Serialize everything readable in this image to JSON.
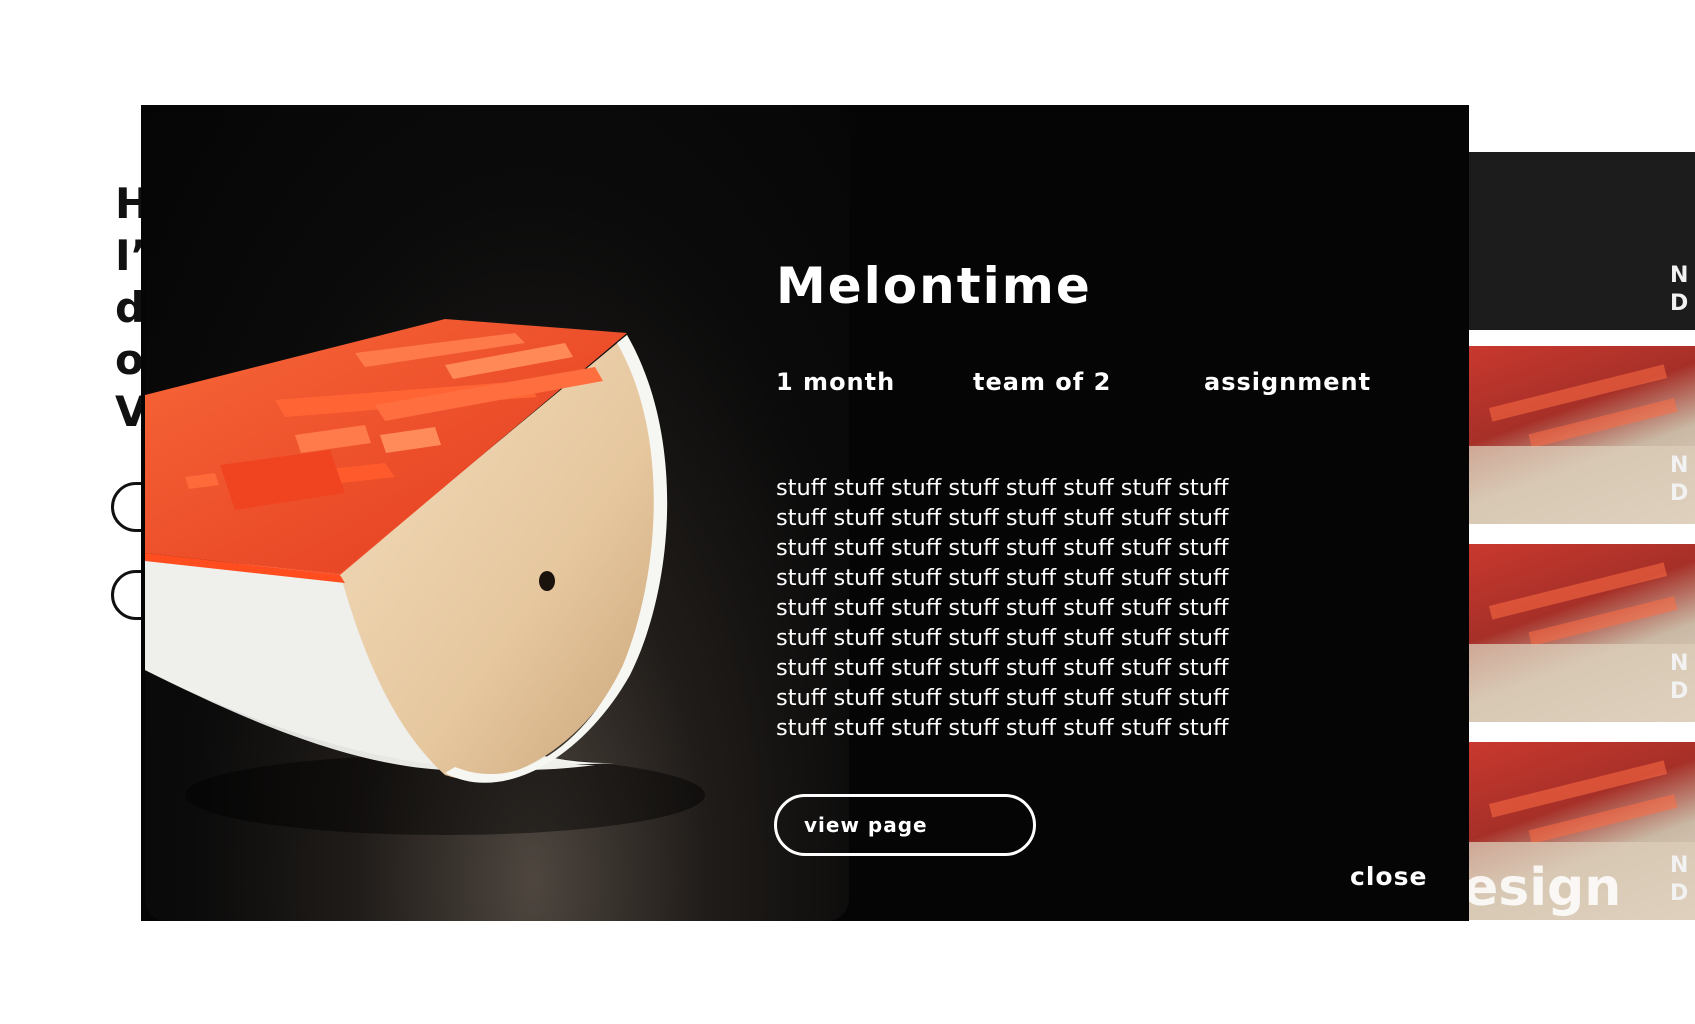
{
  "background": {
    "intro_lines": [
      "H",
      "I’",
      "d",
      "o",
      "V"
    ],
    "pill_1_label": "",
    "pill_2_label": "",
    "side_labels": [
      [
        "N",
        "D"
      ],
      [
        "N",
        "D"
      ],
      [
        "N",
        "D"
      ],
      [
        "N",
        "D"
      ]
    ],
    "partial_heading": "esign"
  },
  "modal": {
    "title": "Melontime",
    "meta": {
      "duration": "1 month",
      "team": "team of 2",
      "type": "assignment"
    },
    "description": "stuff stuff stuff stuff stuff stuff stuff stuff\nstuff stuff stuff stuff  stuff stuff stuff stuff\nstuff stuff stuff stuff stuff stuff stuff stuff\nstuff stuff stuff stuff stuff stuff stuff stuff\nstuff stuff stuff stuff  stuff stuff stuff stuff\nstuff stuff stuff stuff stuff stuff stuff stuff\nstuff stuff stuff stuff stuff stuff stuff stuff\nstuff stuff stuff stuff  stuff stuff stuff stuff\nstuff stuff stuff stuff stuff stuff stuff stuff",
    "view_button_label": "view page",
    "close_label": "close"
  },
  "colors": {
    "modal_background": "#050505",
    "acrylic_orange": "#ff5a2a",
    "plywood": "#e9cfa9"
  },
  "icons": {
    "product_image": "melontime-rocker-photo"
  }
}
